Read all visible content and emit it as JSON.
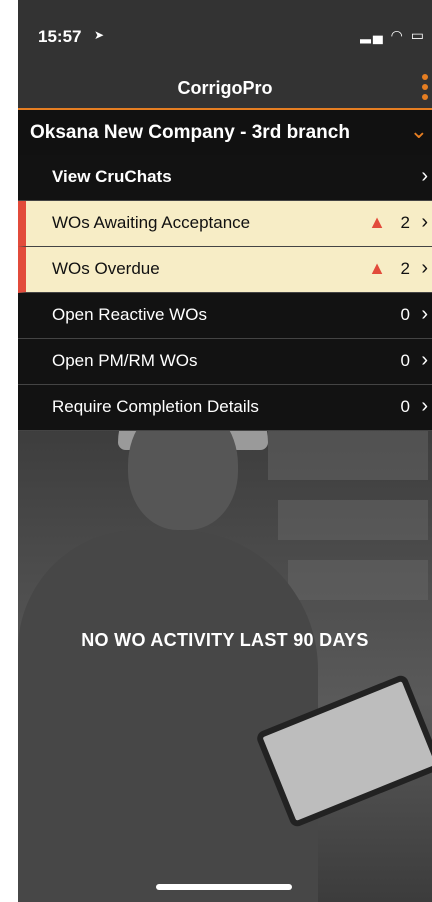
{
  "status": {
    "time": "15:57",
    "location_arrow": "➤",
    "icons": "▂▄ ◠ ▭"
  },
  "header": {
    "title": "CorrigoPro"
  },
  "company": {
    "name": "Oksana New Company - 3rd branch",
    "chevron": "⌄"
  },
  "menu": [
    {
      "label": "View CruChats",
      "count": "",
      "warning": false,
      "chevron": "›"
    },
    {
      "label": "WOs Awaiting Acceptance",
      "count": "2",
      "warning": true,
      "chevron": "›"
    },
    {
      "label": "WOs Overdue",
      "count": "2",
      "warning": true,
      "chevron": "›"
    },
    {
      "label": "Open Reactive WOs",
      "count": "0",
      "warning": false,
      "chevron": "›"
    },
    {
      "label": "Open PM/RM WOs",
      "count": "0",
      "warning": false,
      "chevron": "›"
    },
    {
      "label": "Require Completion Details",
      "count": "0",
      "warning": false,
      "chevron": "›"
    }
  ],
  "alert_glyph": "▲",
  "empty_state": {
    "message": "NO WO ACTIVITY LAST 90 DAYS"
  },
  "colors": {
    "accent": "#e67e22",
    "warning_bg": "#f7edc6",
    "warning_bar": "#e24b3b"
  }
}
